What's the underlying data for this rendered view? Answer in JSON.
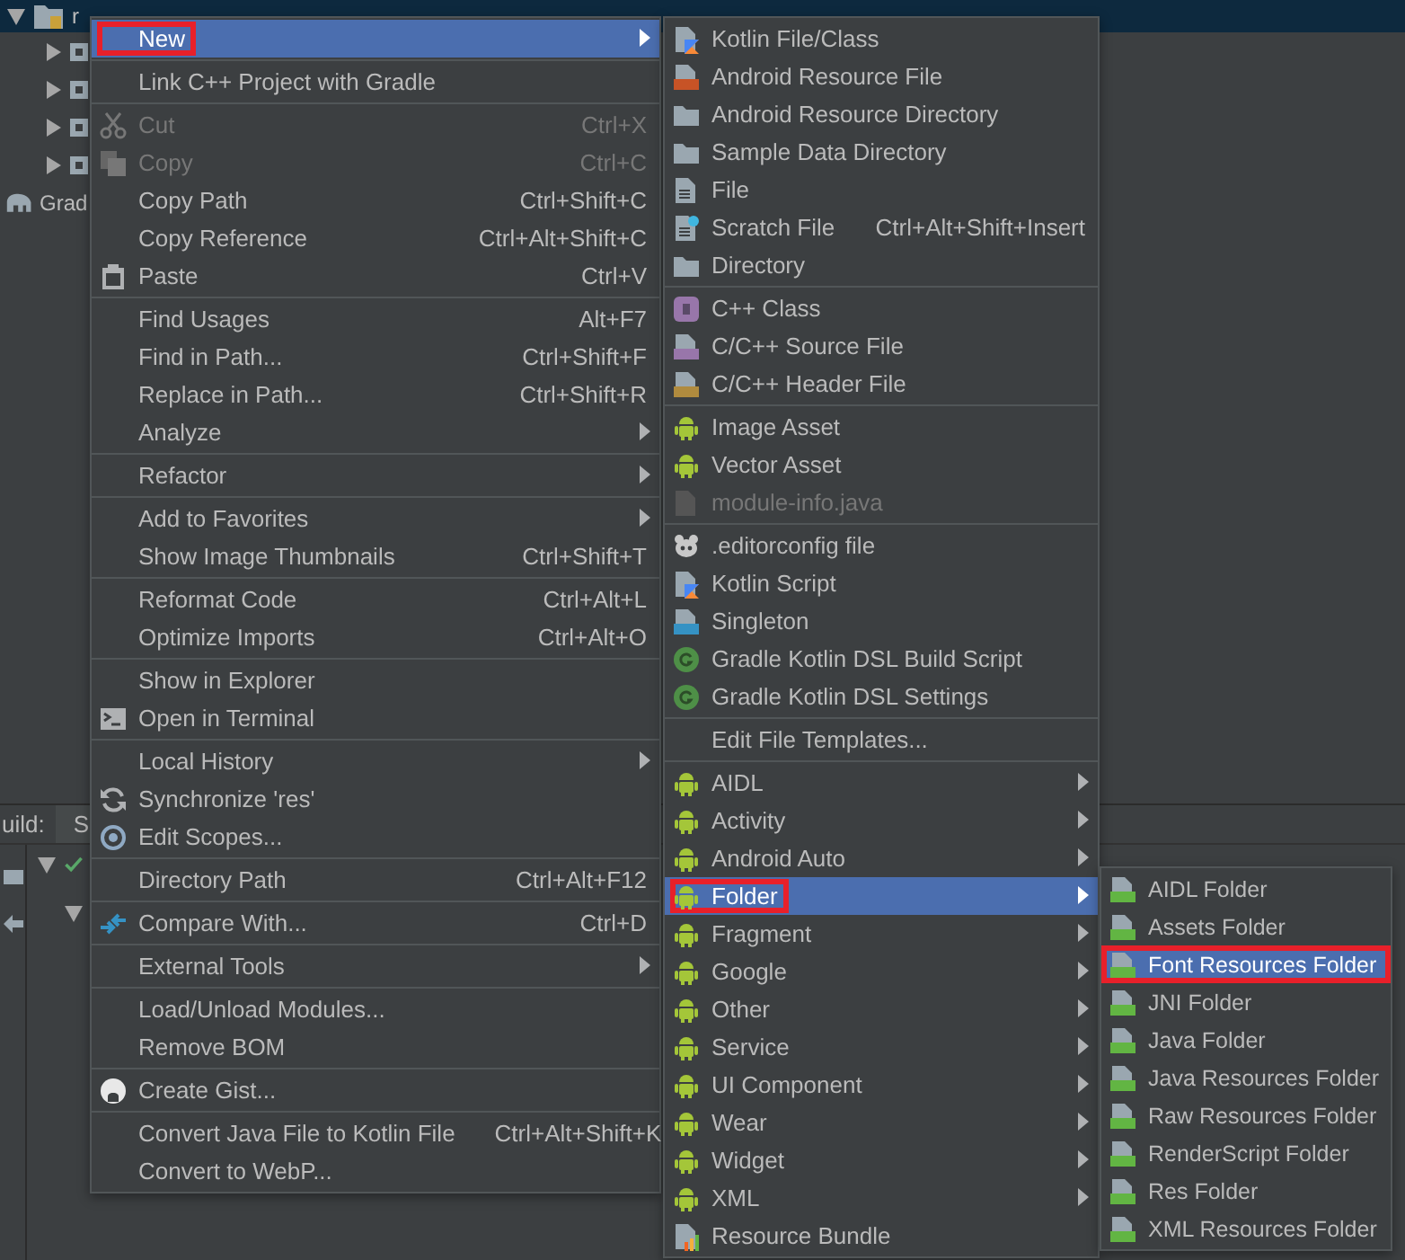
{
  "project_tree": {
    "items": [
      {
        "kind": "root",
        "label": "r",
        "selected": true,
        "expanded": true
      },
      {
        "kind": "module",
        "expanded": false
      },
      {
        "kind": "module",
        "expanded": false
      },
      {
        "kind": "module",
        "expanded": false
      },
      {
        "kind": "module",
        "expanded": false
      },
      {
        "kind": "gradle",
        "label": "Grad"
      }
    ]
  },
  "build_panel": {
    "tab_label": "uild:",
    "tab_2": "S"
  },
  "context_menu": {
    "items": [
      {
        "kind": "plain",
        "label": "New",
        "submenu": true,
        "disabled": false,
        "highlighted": true,
        "annotated": true
      },
      {
        "kind": "separator"
      },
      {
        "kind": "plain",
        "label": "Link C++ Project with Gradle",
        "submenu": false,
        "disabled": false,
        "highlighted": false,
        "annotated": false
      },
      {
        "kind": "separator"
      },
      {
        "kind": "scissors",
        "label": "Cut",
        "shortcut": "Ctrl+X",
        "submenu": false,
        "disabled": true,
        "highlighted": false,
        "annotated": false
      },
      {
        "kind": "copy",
        "label": "Copy",
        "shortcut": "Ctrl+C",
        "submenu": false,
        "disabled": true,
        "highlighted": false,
        "annotated": false
      },
      {
        "kind": "plain",
        "label": "Copy Path",
        "shortcut": "Ctrl+Shift+C",
        "submenu": false,
        "disabled": false,
        "highlighted": false,
        "annotated": false
      },
      {
        "kind": "plain",
        "label": "Copy Reference",
        "shortcut": "Ctrl+Alt+Shift+C",
        "submenu": false,
        "disabled": false,
        "highlighted": false,
        "annotated": false
      },
      {
        "kind": "paste",
        "label": "Paste",
        "shortcut": "Ctrl+V",
        "submenu": false,
        "disabled": false,
        "highlighted": false,
        "annotated": false
      },
      {
        "kind": "separator"
      },
      {
        "kind": "plain",
        "label": "Find Usages",
        "shortcut": "Alt+F7",
        "submenu": false,
        "disabled": false,
        "highlighted": false,
        "annotated": false
      },
      {
        "kind": "plain",
        "label": "Find in Path...",
        "shortcut": "Ctrl+Shift+F",
        "submenu": false,
        "disabled": false,
        "highlighted": false,
        "annotated": false
      },
      {
        "kind": "plain",
        "label": "Replace in Path...",
        "shortcut": "Ctrl+Shift+R",
        "submenu": false,
        "disabled": false,
        "highlighted": false,
        "annotated": false
      },
      {
        "kind": "plain",
        "label": "Analyze",
        "submenu": true,
        "disabled": false,
        "highlighted": false,
        "annotated": false
      },
      {
        "kind": "separator"
      },
      {
        "kind": "plain",
        "label": "Refactor",
        "submenu": true,
        "disabled": false,
        "highlighted": false,
        "annotated": false
      },
      {
        "kind": "separator"
      },
      {
        "kind": "plain",
        "label": "Add to Favorites",
        "submenu": true,
        "disabled": false,
        "highlighted": false,
        "annotated": false
      },
      {
        "kind": "plain",
        "label": "Show Image Thumbnails",
        "shortcut": "Ctrl+Shift+T",
        "submenu": false,
        "disabled": false,
        "highlighted": false,
        "annotated": false
      },
      {
        "kind": "separator"
      },
      {
        "kind": "plain",
        "label": "Reformat Code",
        "shortcut": "Ctrl+Alt+L",
        "submenu": false,
        "disabled": false,
        "highlighted": false,
        "annotated": false
      },
      {
        "kind": "plain",
        "label": "Optimize Imports",
        "shortcut": "Ctrl+Alt+O",
        "submenu": false,
        "disabled": false,
        "highlighted": false,
        "annotated": false
      },
      {
        "kind": "separator"
      },
      {
        "kind": "plain",
        "label": "Show in Explorer",
        "submenu": false,
        "disabled": false,
        "highlighted": false,
        "annotated": false
      },
      {
        "kind": "terminal",
        "label": "Open in Terminal",
        "submenu": false,
        "disabled": false,
        "highlighted": false,
        "annotated": false
      },
      {
        "kind": "separator"
      },
      {
        "kind": "plain",
        "label": "Local History",
        "submenu": true,
        "disabled": false,
        "highlighted": false,
        "annotated": false
      },
      {
        "kind": "sync",
        "label": "Synchronize 'res'",
        "submenu": false,
        "disabled": false,
        "highlighted": false,
        "annotated": false
      },
      {
        "kind": "scope",
        "label": "Edit Scopes...",
        "submenu": false,
        "disabled": false,
        "highlighted": false,
        "annotated": false
      },
      {
        "kind": "separator"
      },
      {
        "kind": "plain",
        "label": "Directory Path",
        "shortcut": "Ctrl+Alt+F12",
        "submenu": false,
        "disabled": false,
        "highlighted": false,
        "annotated": false
      },
      {
        "kind": "separator"
      },
      {
        "kind": "compare",
        "label": "Compare With...",
        "shortcut": "Ctrl+D",
        "submenu": false,
        "disabled": false,
        "highlighted": false,
        "annotated": false
      },
      {
        "kind": "separator"
      },
      {
        "kind": "plain",
        "label": "External Tools",
        "submenu": true,
        "disabled": false,
        "highlighted": false,
        "annotated": false
      },
      {
        "kind": "separator"
      },
      {
        "kind": "plain",
        "label": "Load/Unload Modules...",
        "submenu": false,
        "disabled": false,
        "highlighted": false,
        "annotated": false
      },
      {
        "kind": "plain",
        "label": "Remove BOM",
        "submenu": false,
        "disabled": false,
        "highlighted": false,
        "annotated": false
      },
      {
        "kind": "separator"
      },
      {
        "kind": "github",
        "label": "Create Gist...",
        "submenu": false,
        "disabled": false,
        "highlighted": false,
        "annotated": false
      },
      {
        "kind": "separator"
      },
      {
        "kind": "plain",
        "label": "Convert Java File to Kotlin File",
        "shortcut": "Ctrl+Alt+Shift+K",
        "submenu": false,
        "disabled": false,
        "highlighted": false,
        "annotated": false
      },
      {
        "kind": "plain",
        "label": "Convert to WebP...",
        "submenu": false,
        "disabled": false,
        "highlighted": false,
        "annotated": false
      }
    ]
  },
  "new_submenu": {
    "items": [
      {
        "kind": "kotlin-file",
        "label": "Kotlin File/Class",
        "submenu": false,
        "disabled": false,
        "highlighted": false,
        "annotated": false
      },
      {
        "kind": "resource-file",
        "label": "Android Resource File",
        "submenu": false,
        "disabled": false,
        "highlighted": false,
        "annotated": false
      },
      {
        "kind": "folder",
        "label": "Android Resource Directory",
        "submenu": false,
        "disabled": false,
        "highlighted": false,
        "annotated": false
      },
      {
        "kind": "folder",
        "label": "Sample Data Directory",
        "submenu": false,
        "disabled": false,
        "highlighted": false,
        "annotated": false
      },
      {
        "kind": "file",
        "label": "File",
        "submenu": false,
        "disabled": false,
        "highlighted": false,
        "annotated": false
      },
      {
        "kind": "scratch",
        "label": "Scratch File",
        "shortcut": "Ctrl+Alt+Shift+Insert",
        "submenu": false,
        "disabled": false,
        "highlighted": false,
        "annotated": false
      },
      {
        "kind": "folder",
        "label": "Directory",
        "submenu": false,
        "disabled": false,
        "highlighted": false,
        "annotated": false
      },
      {
        "kind": "separator"
      },
      {
        "kind": "cpp-class",
        "label": "C++ Class",
        "submenu": false,
        "disabled": false,
        "highlighted": false,
        "annotated": false
      },
      {
        "kind": "cpp-source",
        "label": "C/C++ Source File",
        "submenu": false,
        "disabled": false,
        "highlighted": false,
        "annotated": false
      },
      {
        "kind": "cpp-header",
        "label": "C/C++ Header File",
        "submenu": false,
        "disabled": false,
        "highlighted": false,
        "annotated": false
      },
      {
        "kind": "separator"
      },
      {
        "kind": "android",
        "label": "Image Asset",
        "submenu": false,
        "disabled": false,
        "highlighted": false,
        "annotated": false
      },
      {
        "kind": "android",
        "label": "Vector Asset",
        "submenu": false,
        "disabled": false,
        "highlighted": false,
        "annotated": false
      },
      {
        "kind": "java-file",
        "label": "module-info.java",
        "submenu": false,
        "disabled": true,
        "highlighted": false,
        "annotated": false
      },
      {
        "kind": "separator"
      },
      {
        "kind": "editorconfig",
        "label": ".editorconfig file",
        "submenu": false,
        "disabled": false,
        "highlighted": false,
        "annotated": false
      },
      {
        "kind": "kotlin-script",
        "label": "Kotlin Script",
        "submenu": false,
        "disabled": false,
        "highlighted": false,
        "annotated": false
      },
      {
        "kind": "singleton",
        "label": "Singleton",
        "submenu": false,
        "disabled": false,
        "highlighted": false,
        "annotated": false
      },
      {
        "kind": "gradle",
        "label": "Gradle Kotlin DSL Build Script",
        "submenu": false,
        "disabled": false,
        "highlighted": false,
        "annotated": false
      },
      {
        "kind": "gradle",
        "label": "Gradle Kotlin DSL Settings",
        "submenu": false,
        "disabled": false,
        "highlighted": false,
        "annotated": false
      },
      {
        "kind": "separator"
      },
      {
        "kind": "plain",
        "label": "Edit File Templates...",
        "submenu": false,
        "disabled": false,
        "highlighted": false,
        "annotated": false
      },
      {
        "kind": "separator"
      },
      {
        "kind": "android",
        "label": "AIDL",
        "submenu": true,
        "disabled": false,
        "highlighted": false,
        "annotated": false
      },
      {
        "kind": "android",
        "label": "Activity",
        "submenu": true,
        "disabled": false,
        "highlighted": false,
        "annotated": false
      },
      {
        "kind": "android",
        "label": "Android Auto",
        "submenu": true,
        "disabled": false,
        "highlighted": false,
        "annotated": false
      },
      {
        "kind": "android",
        "label": "Folder",
        "submenu": true,
        "disabled": false,
        "highlighted": true,
        "annotated": true
      },
      {
        "kind": "android",
        "label": "Fragment",
        "submenu": true,
        "disabled": false,
        "highlighted": false,
        "annotated": false
      },
      {
        "kind": "android",
        "label": "Google",
        "submenu": true,
        "disabled": false,
        "highlighted": false,
        "annotated": false
      },
      {
        "kind": "android",
        "label": "Other",
        "submenu": true,
        "disabled": false,
        "highlighted": false,
        "annotated": false
      },
      {
        "kind": "android",
        "label": "Service",
        "submenu": true,
        "disabled": false,
        "highlighted": false,
        "annotated": false
      },
      {
        "kind": "android",
        "label": "UI Component",
        "submenu": true,
        "disabled": false,
        "highlighted": false,
        "annotated": false
      },
      {
        "kind": "android",
        "label": "Wear",
        "submenu": true,
        "disabled": false,
        "highlighted": false,
        "annotated": false
      },
      {
        "kind": "android",
        "label": "Widget",
        "submenu": true,
        "disabled": false,
        "highlighted": false,
        "annotated": false
      },
      {
        "kind": "android",
        "label": "XML",
        "submenu": true,
        "disabled": false,
        "highlighted": false,
        "annotated": false
      },
      {
        "kind": "bundle",
        "label": "Resource Bundle",
        "submenu": false,
        "disabled": false,
        "highlighted": false,
        "annotated": false
      }
    ]
  },
  "folder_submenu": {
    "items": [
      {
        "kind": "folder-green",
        "label": "AIDL Folder",
        "submenu": false,
        "disabled": false,
        "highlighted": false,
        "annotated": false
      },
      {
        "kind": "folder-green",
        "label": "Assets Folder",
        "submenu": false,
        "disabled": false,
        "highlighted": false,
        "annotated": false
      },
      {
        "kind": "folder-green",
        "label": "Font Resources Folder",
        "submenu": false,
        "disabled": false,
        "highlighted": true,
        "annotated": true
      },
      {
        "kind": "folder-green",
        "label": "JNI Folder",
        "submenu": false,
        "disabled": false,
        "highlighted": false,
        "annotated": false
      },
      {
        "kind": "folder-green",
        "label": "Java Folder",
        "submenu": false,
        "disabled": false,
        "highlighted": false,
        "annotated": false
      },
      {
        "kind": "folder-green",
        "label": "Java Resources Folder",
        "submenu": false,
        "disabled": false,
        "highlighted": false,
        "annotated": false
      },
      {
        "kind": "folder-green",
        "label": "Raw Resources Folder",
        "submenu": false,
        "disabled": false,
        "highlighted": false,
        "annotated": false
      },
      {
        "kind": "folder-green",
        "label": "RenderScript Folder",
        "submenu": false,
        "disabled": false,
        "highlighted": false,
        "annotated": false
      },
      {
        "kind": "folder-green",
        "label": "Res Folder",
        "submenu": false,
        "disabled": false,
        "highlighted": false,
        "annotated": false
      },
      {
        "kind": "folder-green",
        "label": "XML Resources Folder",
        "submenu": false,
        "disabled": false,
        "highlighted": false,
        "annotated": false
      }
    ]
  }
}
